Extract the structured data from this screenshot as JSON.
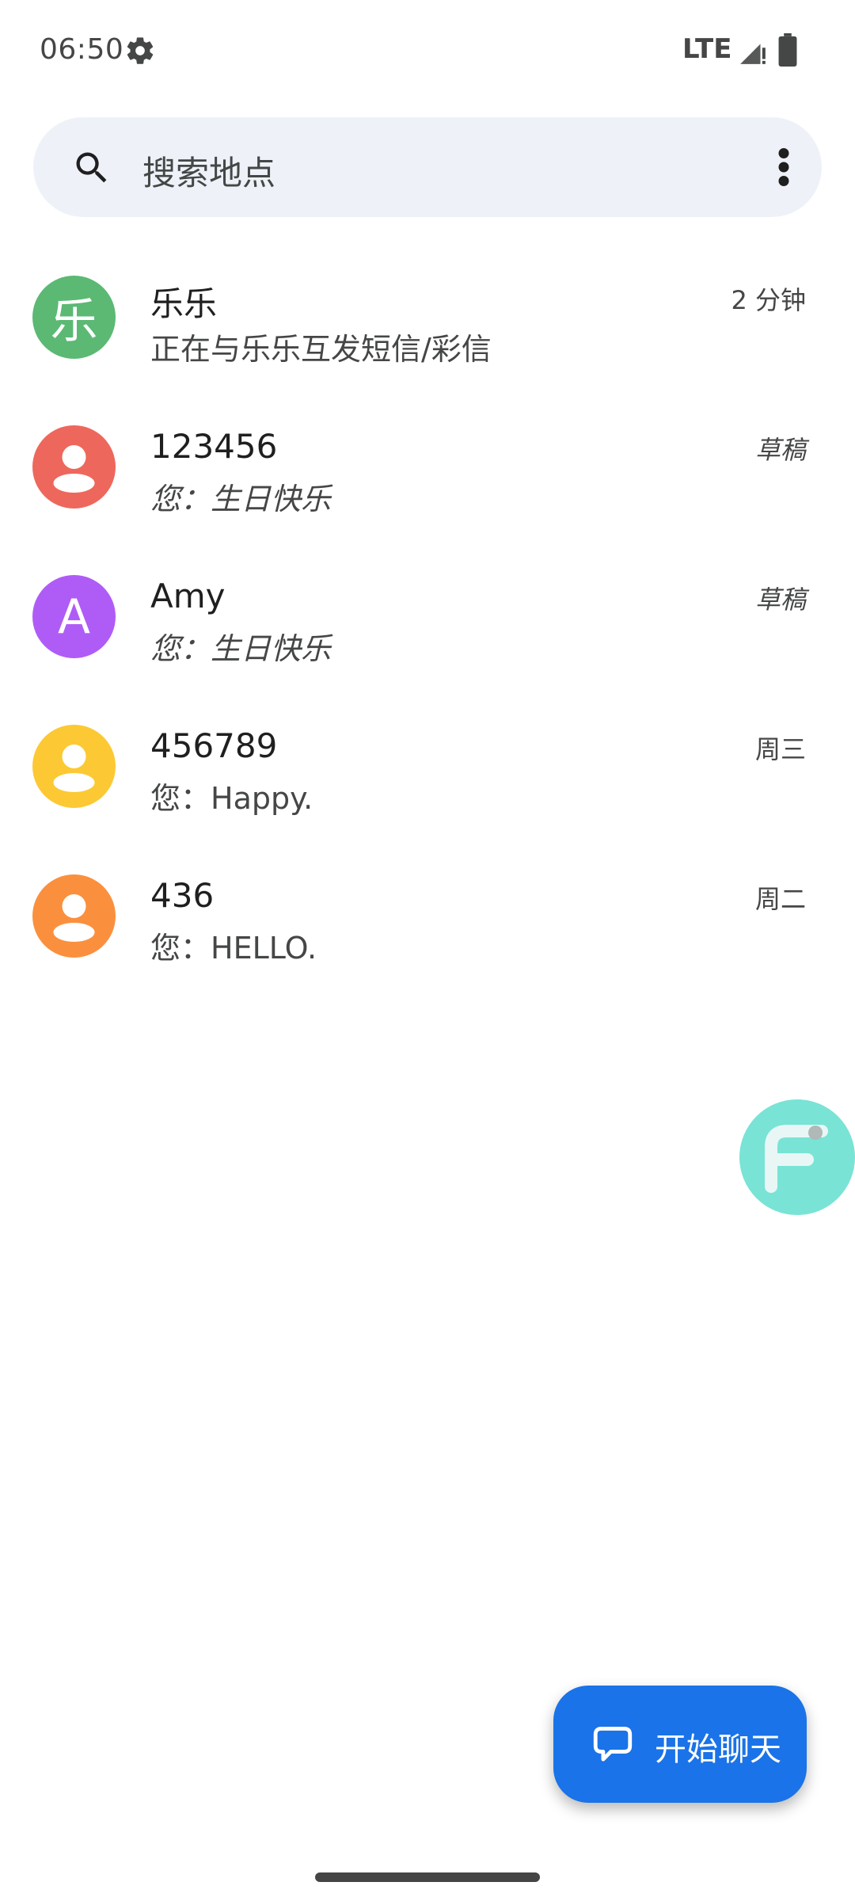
{
  "status_bar": {
    "time": "06:50",
    "network": "LTE",
    "icons": [
      "gear-icon",
      "signal-icon",
      "battery-icon"
    ]
  },
  "search": {
    "placeholder": "搜索地点",
    "icons": [
      "search-icon",
      "more-vert-icon"
    ]
  },
  "conversations": [
    {
      "name": "乐乐",
      "snippet": "正在与乐乐互发短信/彩信",
      "time": "2 分钟",
      "avatar_type": "letter",
      "avatar_letter": "乐",
      "avatar_color": "#5bb974",
      "is_draft": false
    },
    {
      "name": "123456",
      "snippet": "您：生日快乐",
      "time": "草稿",
      "avatar_type": "person",
      "avatar_color": "#ee675c",
      "is_draft": true
    },
    {
      "name": "Amy",
      "snippet": "您：生日快乐",
      "time": "草稿",
      "avatar_type": "letter",
      "avatar_letter": "A",
      "avatar_color": "#af5cf7",
      "is_draft": true
    },
    {
      "name": "456789",
      "snippet": "您：Happy.",
      "time": "周三",
      "avatar_type": "person",
      "avatar_color": "#fcc934",
      "is_draft": false
    },
    {
      "name": "436",
      "snippet": "您：HELLO.",
      "time": "周二",
      "avatar_type": "person",
      "avatar_color": "#fa903e",
      "is_draft": false
    }
  ],
  "floating_bubble": {
    "icon": "f-app-icon",
    "color": "#79e3d6"
  },
  "fab": {
    "label": "开始聊天",
    "icon": "chat-bubble-icon",
    "color": "#1a73e8"
  }
}
